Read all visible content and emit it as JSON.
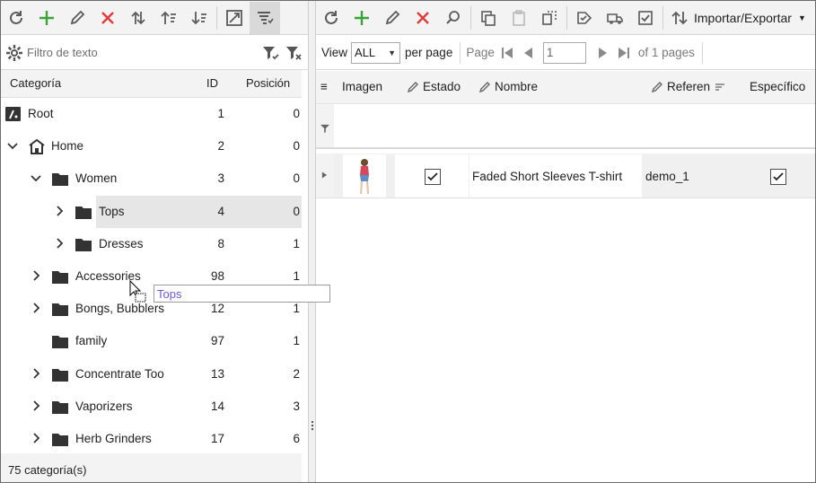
{
  "left_toolbar": [
    "refresh-icon",
    "add-icon",
    "edit-icon",
    "delete-icon",
    "move-up-down-icon",
    "sort-ascending-icon",
    "sort-descending-icon",
    "expand-image-icon",
    "filter-list-icon"
  ],
  "right_toolbar": [
    "refresh-icon",
    "add-icon",
    "edit-icon",
    "delete-icon",
    "search-icon",
    "copy-icon",
    "paste-icon",
    "duplicate-icon",
    "move-to-category-icon",
    "truck-icon",
    "checklist-icon"
  ],
  "import_export": {
    "label": "Importar/Exportar"
  },
  "filter": {
    "placeholder": "Filtro de texto"
  },
  "tree_columns": {
    "category": "Categoría",
    "id": "ID",
    "position": "Posición"
  },
  "tree_rows": [
    {
      "name": "Root",
      "id": "1",
      "position": "0",
      "level": 0,
      "expander": "none",
      "icon": "root"
    },
    {
      "name": "Home",
      "id": "2",
      "position": "0",
      "level": 0,
      "expander": "expanded",
      "icon": "home"
    },
    {
      "name": "Women",
      "id": "3",
      "position": "0",
      "level": 1,
      "expander": "expanded",
      "icon": "folder"
    },
    {
      "name": "Tops",
      "id": "4",
      "position": "0",
      "level": 2,
      "expander": "collapsed",
      "icon": "folder",
      "selected": true
    },
    {
      "name": "Dresses",
      "id": "8",
      "position": "1",
      "level": 2,
      "expander": "collapsed",
      "icon": "folder"
    },
    {
      "name": "Accessories",
      "id": "98",
      "position": "1",
      "level": 1,
      "expander": "collapsed",
      "icon": "folder"
    },
    {
      "name": "Bongs, Bubblers",
      "id": "12",
      "position": "1",
      "level": 1,
      "expander": "collapsed",
      "icon": "folder"
    },
    {
      "name": "family",
      "id": "97",
      "position": "1",
      "level": 1,
      "expander": "none",
      "icon": "folder"
    },
    {
      "name": "Concentrate Too",
      "id": "13",
      "position": "2",
      "level": 1,
      "expander": "collapsed",
      "icon": "folder"
    },
    {
      "name": "Vaporizers",
      "id": "14",
      "position": "3",
      "level": 1,
      "expander": "collapsed",
      "icon": "folder"
    },
    {
      "name": "Herb Grinders",
      "id": "17",
      "position": "6",
      "level": 1,
      "expander": "collapsed",
      "icon": "folder"
    }
  ],
  "status": {
    "count_text": "75 categoría(s)"
  },
  "drag": {
    "label": "Tops"
  },
  "pager": {
    "view_label": "View",
    "view_value": "ALL",
    "per_page": "per page",
    "page_label": "Page",
    "page_value": "1",
    "of_pages": "of 1 pages"
  },
  "grid_columns": {
    "image": "Imagen",
    "status": "Estado",
    "name": "Nombre",
    "reference": "Referen",
    "specific": "Específico"
  },
  "grid_rows": [
    {
      "name": "Faded Short Sleeves T-shirt",
      "reference": "demo_1",
      "status_checked": true,
      "specific_checked": true
    }
  ],
  "colors": {
    "add": "#3aa335",
    "delete": "#e03b3b",
    "icon": "#5a5a5a",
    "drag_text": "#6a5acd"
  }
}
